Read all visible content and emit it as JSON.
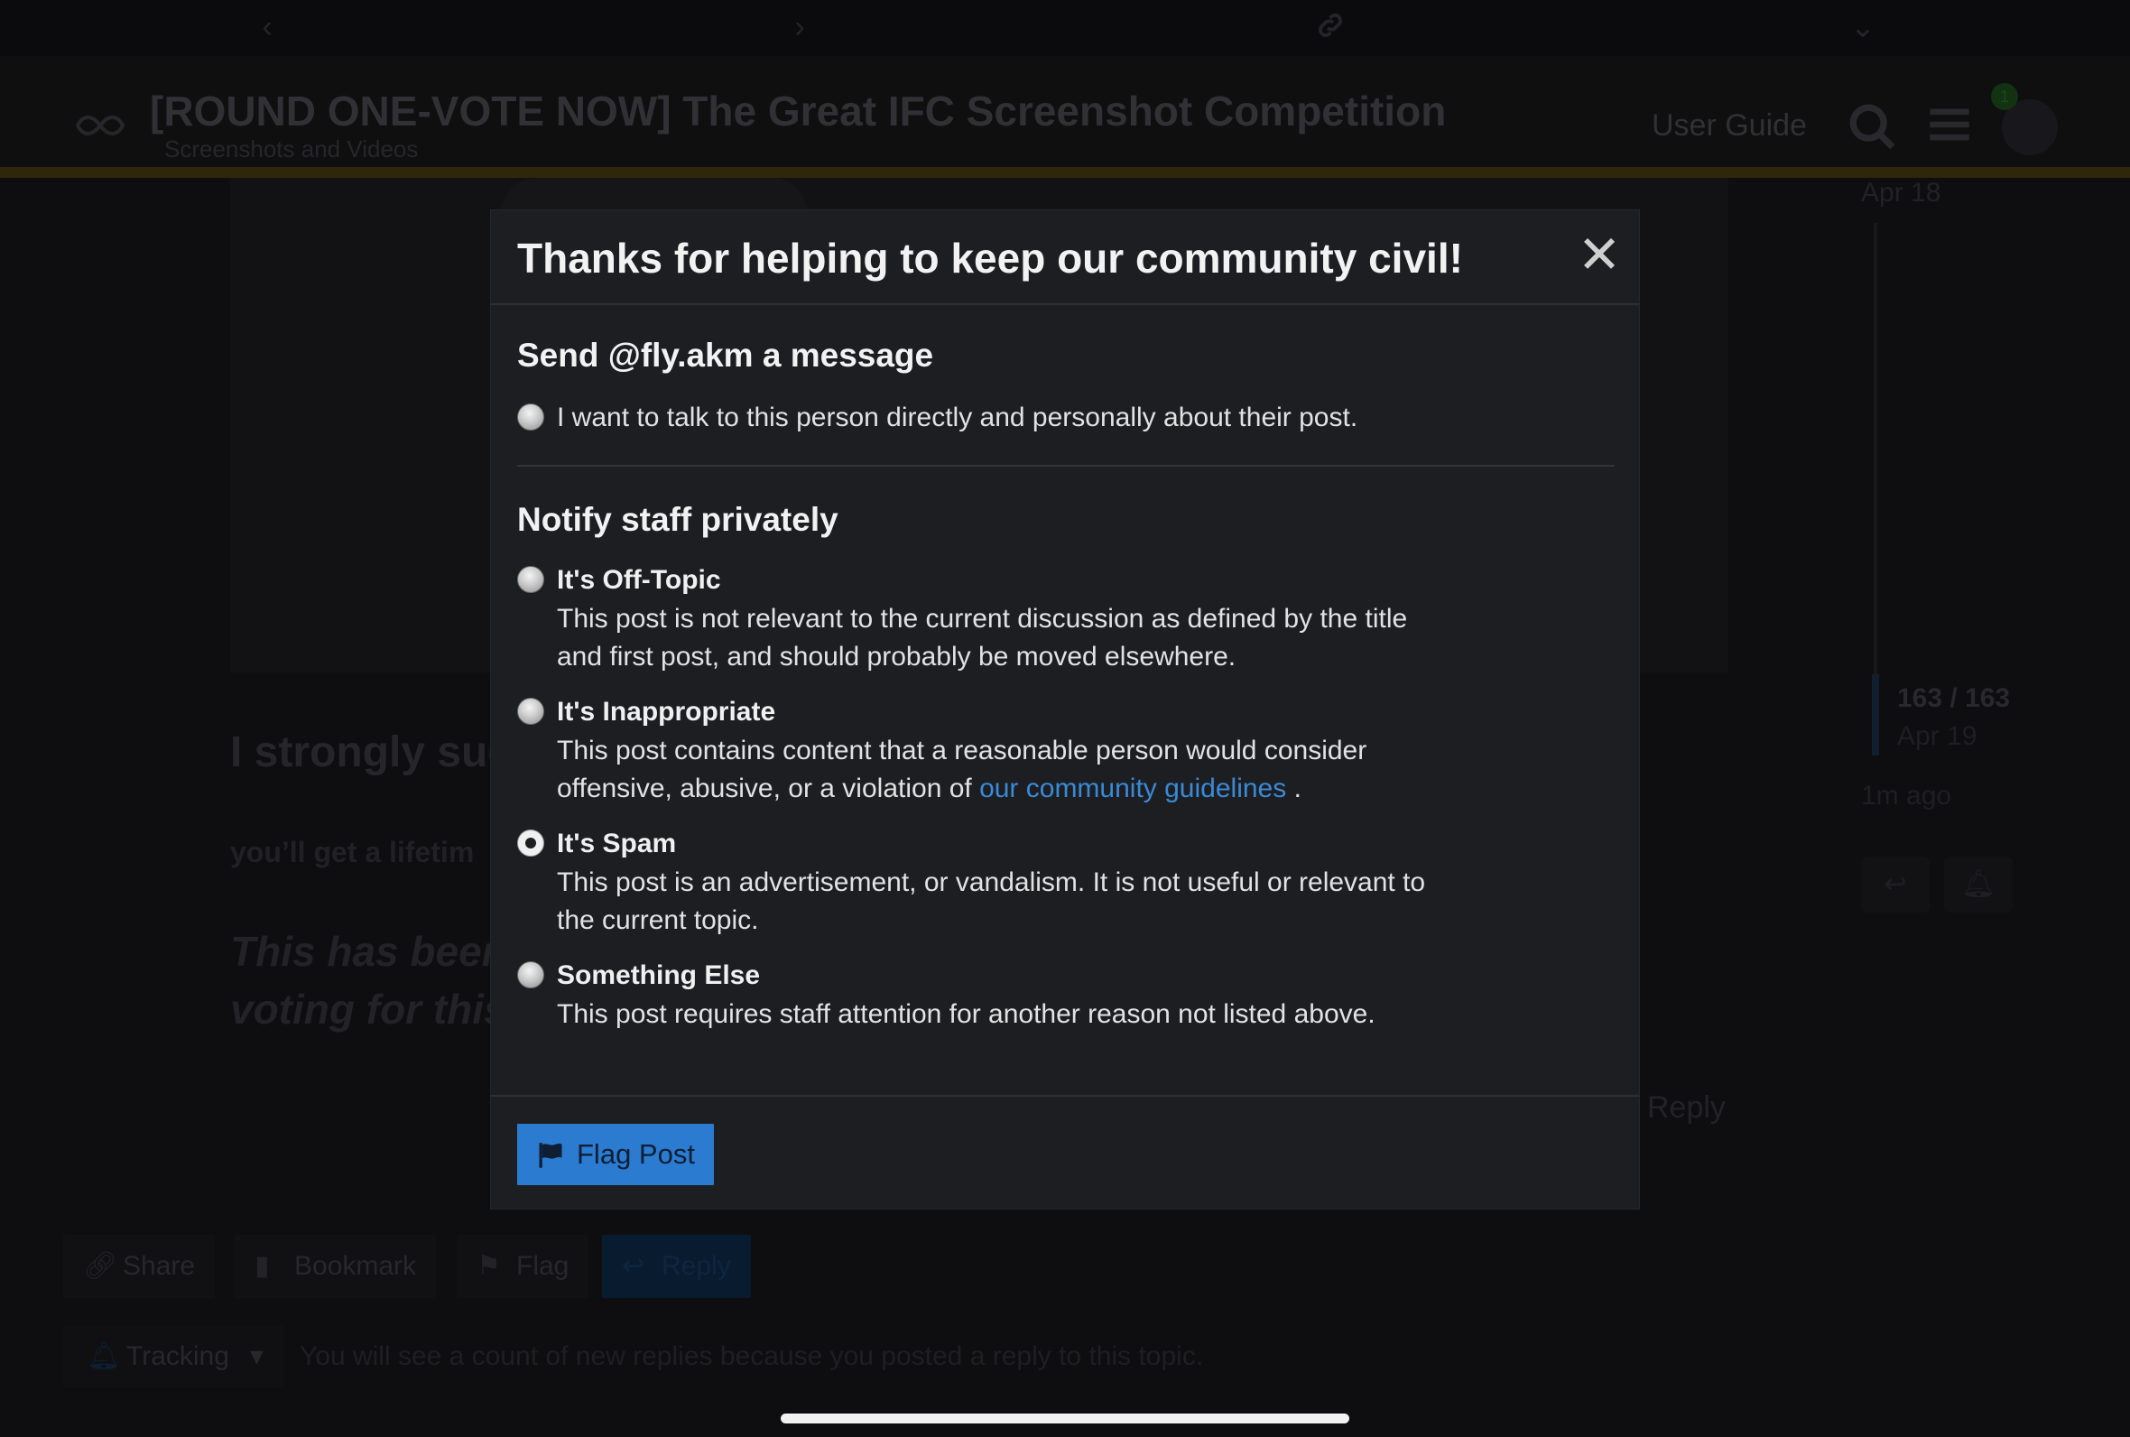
{
  "background": {
    "topic_title": "[ROUND ONE-VOTE NOW] The Great IFC Screenshot Competition",
    "category": "Screenshots and Videos",
    "user_guide": "User Guide",
    "notification_count": "1",
    "post_heading": "I strongly sug",
    "post_line": "you’ll get a lifetim",
    "post_italic_1": "This has beer",
    "post_italic_2": "voting for this",
    "reply_right": "Reply",
    "timeline": {
      "top_date": "Apr 18",
      "count": "163 / 163",
      "bottom_date": "Apr 19",
      "ago": "1m ago"
    },
    "actions": {
      "share": "Share",
      "bookmark": "Bookmark",
      "flag": "Flag",
      "reply": "Reply"
    },
    "tracking": {
      "label": "Tracking",
      "text": "You will see a count of new replies because you posted a reply to this topic."
    }
  },
  "modal": {
    "title": "Thanks for helping to keep our community civil!",
    "close_icon": "close-icon",
    "message_section": {
      "title": "Send @fly.akm a message",
      "option": "I want to talk to this person directly and personally about their post."
    },
    "notify_section": {
      "title": "Notify staff privately",
      "options": [
        {
          "label": "It's Off-Topic",
          "desc": "This post is not relevant to the current discussion as defined by the title and first post, and should probably be moved elsewhere.",
          "checked": false
        },
        {
          "label": "It's Inappropriate",
          "desc_before": "This post contains content that a reasonable person would consider offensive, abusive, or a violation of ",
          "link": "our community guidelines",
          "desc_after": " .",
          "checked": false
        },
        {
          "label": "It's Spam",
          "desc": "This post is an advertisement, or vandalism. It is not useful or relevant to the current topic.",
          "checked": true
        },
        {
          "label": "Something Else",
          "desc": "This post requires staff attention for another reason not listed above.",
          "checked": false
        }
      ]
    },
    "submit": {
      "label": "Flag Post",
      "color": "#2b7bd1"
    }
  }
}
